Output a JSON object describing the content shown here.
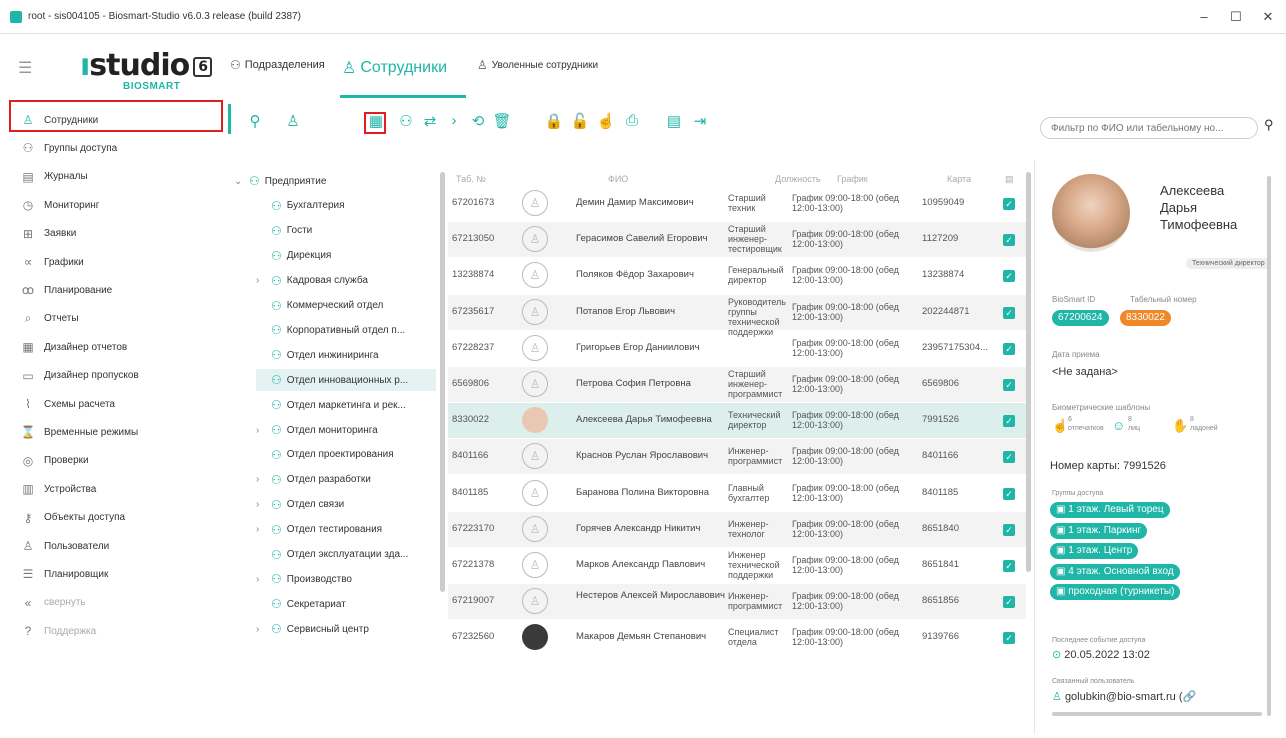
{
  "window": {
    "title": "root - sis004105 - Biosmart-Studio v6.0.3 release (build 2387)"
  },
  "logo": {
    "main": "studio",
    "version": "6",
    "sub": "BIOSMART"
  },
  "topnav": {
    "departments": "Подразделения",
    "employees": "Сотрудники",
    "fired": "Уволенные сотрудники"
  },
  "sidebar": {
    "items": [
      {
        "label": "Сотрудники",
        "icon": "person-icon"
      },
      {
        "label": "Группы доступа",
        "icon": "group-icon"
      },
      {
        "label": "Журналы",
        "icon": "journal-icon"
      },
      {
        "label": "Мониторинг",
        "icon": "monitor-icon"
      },
      {
        "label": "Заявки",
        "icon": "request-icon"
      },
      {
        "label": "Графики",
        "icon": "schedule-icon"
      },
      {
        "label": "Планирование",
        "icon": "planning-icon"
      },
      {
        "label": "Отчеты",
        "icon": "report-icon"
      },
      {
        "label": "Дизайнер отчетов",
        "icon": "report-designer-icon"
      },
      {
        "label": "Дизайнер пропусков",
        "icon": "pass-designer-icon"
      },
      {
        "label": "Схемы расчета",
        "icon": "calc-scheme-icon"
      },
      {
        "label": "Временные режимы",
        "icon": "time-mode-icon"
      },
      {
        "label": "Проверки",
        "icon": "check-icon"
      },
      {
        "label": "Устройства",
        "icon": "devices-icon"
      },
      {
        "label": "Объекты доступа",
        "icon": "access-object-icon"
      },
      {
        "label": "Пользователи",
        "icon": "users-icon"
      },
      {
        "label": "Планировщик",
        "icon": "scheduler-icon"
      },
      {
        "label": "свернуть",
        "icon": "collapse-icon"
      },
      {
        "label": "Поддержка",
        "icon": "help-icon"
      }
    ]
  },
  "filter": {
    "placeholder": "Фильтр по ФИО или табельному но..."
  },
  "tree": [
    {
      "label": "Предприятие",
      "chev": "⌄",
      "indent": 0
    },
    {
      "label": "Бухгалтерия",
      "chev": "",
      "indent": 1
    },
    {
      "label": "Гости",
      "chev": "",
      "indent": 1
    },
    {
      "label": "Дирекция",
      "chev": "",
      "indent": 1
    },
    {
      "label": "Кадровая служба",
      "chev": "›",
      "indent": 1
    },
    {
      "label": "Коммерческий отдел",
      "chev": "",
      "indent": 1
    },
    {
      "label": "Корпоративный отдел п...",
      "chev": "",
      "indent": 1
    },
    {
      "label": "Отдел инжиниринга",
      "chev": "",
      "indent": 1
    },
    {
      "label": "Отдел инновационных р...",
      "chev": "",
      "indent": 1
    },
    {
      "label": "Отдел маркетинга и рек...",
      "chev": "",
      "indent": 1
    },
    {
      "label": "Отдел мониторинга",
      "chev": "›",
      "indent": 1
    },
    {
      "label": "Отдел проектирования",
      "chev": "",
      "indent": 1
    },
    {
      "label": "Отдел разработки",
      "chev": "›",
      "indent": 1
    },
    {
      "label": "Отдел связи",
      "chev": "›",
      "indent": 1
    },
    {
      "label": "Отдел тестирования",
      "chev": "›",
      "indent": 1
    },
    {
      "label": "Отдел эксплуатации зда...",
      "chev": "",
      "indent": 1
    },
    {
      "label": "Производство",
      "chev": "›",
      "indent": 1
    },
    {
      "label": "Секретариат",
      "chev": "",
      "indent": 1
    },
    {
      "label": "Сервисный центр",
      "chev": "›",
      "indent": 1
    }
  ],
  "grid": {
    "headers": {
      "tab": "Таб. №",
      "fio": "ФИО",
      "pos": "Должность",
      "sched": "График",
      "card": "Карта"
    },
    "rows": [
      {
        "tab": "67201673",
        "fio": "Демин Дамир Максимович",
        "pos": "Старший техник",
        "sched": "График 09:00-18:00 (обед 12:00-13:00)",
        "card": "10959049"
      },
      {
        "tab": "67213050",
        "fio": "Герасимов Савелий Егорович",
        "pos": "Старший инженер-тестировщик",
        "sched": "График 09:00-18:00 (обед 12:00-13:00)",
        "card": "1127209"
      },
      {
        "tab": "13238874",
        "fio": "Поляков Фёдор Захарович",
        "pos": "Генеральный директор",
        "sched": "График 09:00-18:00 (обед 12:00-13:00)",
        "card": "13238874"
      },
      {
        "tab": "67235617",
        "fio": "Потапов Егор Львович",
        "pos": "Руководитель группы технической поддержки",
        "sched": "График 09:00-18:00 (обед 12:00-13:00)",
        "card": "202244871"
      },
      {
        "tab": "67228237",
        "fio": "Григорьев Егор Даниилович",
        "pos": "",
        "sched": "График 09:00-18:00 (обед 12:00-13:00)",
        "card": "23957175304..."
      },
      {
        "tab": "6569806",
        "fio": "Петрова София Петровна",
        "pos": "Старший инженер-программист",
        "sched": "График 09:00-18:00 (обед 12:00-13:00)",
        "card": "6569806"
      },
      {
        "tab": "8330022",
        "fio": "Алексеева Дарья Тимофеевна",
        "pos": "Технический директор",
        "sched": "График 09:00-18:00 (обед 12:00-13:00)",
        "card": "7991526"
      },
      {
        "tab": "8401166",
        "fio": "Краснов Руслан Ярославович",
        "pos": "Инженер-программист",
        "sched": "График 09:00-18:00 (обед 12:00-13:00)",
        "card": "8401166"
      },
      {
        "tab": "8401185",
        "fio": "Баранова Полина Викторовна",
        "pos": "Главный бухгалтер",
        "sched": "График 09:00-18:00 (обед 12:00-13:00)",
        "card": "8401185"
      },
      {
        "tab": "67223170",
        "fio": "Горячев Александр Никитич",
        "pos": "Инженер-технолог",
        "sched": "График 09:00-18:00 (обед 12:00-13:00)",
        "card": "8651840"
      },
      {
        "tab": "67221378",
        "fio": "Марков Александр Павлович",
        "pos": "Инженер технической поддержки",
        "sched": "График 09:00-18:00 (обед 12:00-13:00)",
        "card": "8651841"
      },
      {
        "tab": "67219007",
        "fio": "Нестеров Алексей Мирославович",
        "pos": "Инженер-программист",
        "sched": "График 09:00-18:00 (обед 12:00-13:00)",
        "card": "8651856"
      },
      {
        "tab": "67232560",
        "fio": "Макаров Демьян Степанович",
        "pos": "Специалист отдела",
        "sched": "График 09:00-18:00 (обед 12:00-13:00)",
        "card": "9139766"
      }
    ]
  },
  "detail": {
    "name_line1": "Алексеева",
    "name_line2": "Дарья",
    "name_line3": "Тимофеевна",
    "position": "Технический директор",
    "biosmart_id_label": "BioSmart ID",
    "biosmart_id": "67200624",
    "tab_label": "Табельный номер",
    "tab": "8330022",
    "hire_label": "Дата приема",
    "hire_value": "<Не задана>",
    "bio_label": "Биометрические шаблоны",
    "bio_fingers_count": "6",
    "bio_fingers_label": "отпечатков",
    "bio_faces_count": "8",
    "bio_faces_label": "лиц",
    "bio_palms_count": "8",
    "bio_palms_label": "ладоней",
    "card_line": "Номер карты: 7991526",
    "groups_label": "Группы доступа",
    "groups": [
      "1 этаж. Левый торец",
      "1 этаж. Паркинг",
      "1 этаж. Центр",
      "4 этаж. Основной вход",
      "проходная (турникеты)"
    ],
    "last_event_label": "Последнее событие доступа",
    "last_event": "20.05.2022 13:02",
    "linked_label": "Связанный пользователь",
    "linked_user": "golubkin@bio-smart.ru ("
  },
  "colors": {
    "accent": "#1fb6a8",
    "orange": "#f0882a",
    "highlight": "#e02020"
  }
}
